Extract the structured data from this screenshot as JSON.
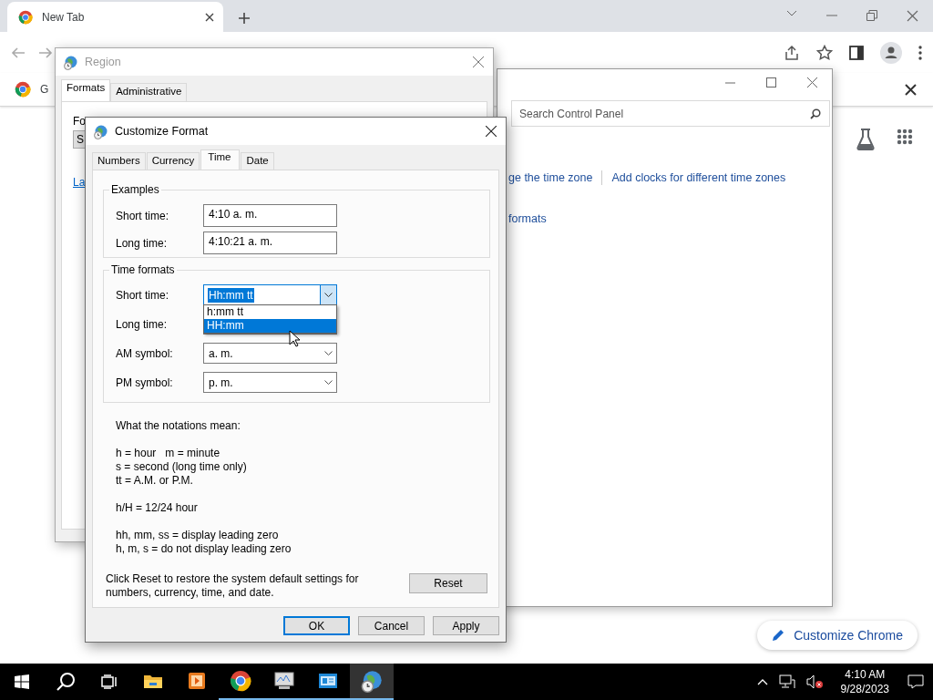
{
  "browser": {
    "tabs": [
      {
        "label": "New Tab",
        "selected": true
      }
    ],
    "bookmarks": [
      {
        "label": "G"
      }
    ],
    "customize_button": "Customize Chrome"
  },
  "control_panel": {
    "search": {
      "placeholder": "Search Control Panel"
    },
    "link_rows": [
      [
        "ge the time zone",
        "Add clocks for different time zones"
      ],
      [
        "formats"
      ]
    ]
  },
  "region_dialog": {
    "title": "Region",
    "active": false,
    "tabs": [
      {
        "label": "Formats",
        "selected": true
      },
      {
        "label": "Administrative",
        "selected": false
      }
    ],
    "format_label": "Fo",
    "format_combo": "S",
    "link": "La"
  },
  "customize_dialog": {
    "title": "Customize Format",
    "active": true,
    "tabs": [
      {
        "label": "Numbers",
        "selected": false
      },
      {
        "label": "Currency",
        "selected": false
      },
      {
        "label": "Time",
        "selected": true
      },
      {
        "label": "Date",
        "selected": false
      }
    ],
    "examples": {
      "title": "Examples",
      "rows": [
        {
          "label": "Short time:",
          "value": "4:10 a. m."
        },
        {
          "label": "Long time:",
          "value": "4:10:21 a. m."
        }
      ]
    },
    "time_formats": {
      "title": "Time formats",
      "rows": [
        {
          "label": "Short time:",
          "kind": "open-combo",
          "value": "Hh:mm tt",
          "options": [
            {
              "label": "h:mm tt",
              "selected": false
            },
            {
              "label": "HH:mm",
              "selected": true
            }
          ]
        },
        {
          "label": "Long time:",
          "kind": "covered"
        },
        {
          "label": "AM symbol:",
          "kind": "combo",
          "value": "a. m."
        },
        {
          "label": "PM symbol:",
          "kind": "combo",
          "value": "p. m."
        }
      ]
    },
    "notes": [
      [
        "What the notations mean:"
      ],
      [
        "h = hour   m = minute",
        "s = second (long time only)",
        "tt = A.M. or P.M."
      ],
      [
        "h/H = 12/24 hour"
      ],
      [
        "hh, mm, ss = display leading zero",
        "h, m, s = do not display leading zero"
      ]
    ],
    "reset": {
      "text": "Click Reset to restore the system default settings for numbers, currency, time, and date.",
      "button": "Reset"
    },
    "buttons": [
      {
        "label": "OK",
        "default": true
      },
      {
        "label": "Cancel",
        "default": false
      },
      {
        "label": "Apply",
        "default": false
      }
    ]
  },
  "taskbar": {
    "apps": [
      {
        "kind": "files",
        "running": false,
        "active": false
      },
      {
        "kind": "media",
        "running": false,
        "active": false
      },
      {
        "kind": "browser",
        "running": true,
        "active": false
      },
      {
        "kind": "monitor",
        "running": true,
        "active": false
      },
      {
        "kind": "card",
        "running": true,
        "active": false
      },
      {
        "kind": "globe",
        "running": true,
        "active": true
      }
    ],
    "time": "4:10 AM",
    "date": "9/28/2023"
  }
}
